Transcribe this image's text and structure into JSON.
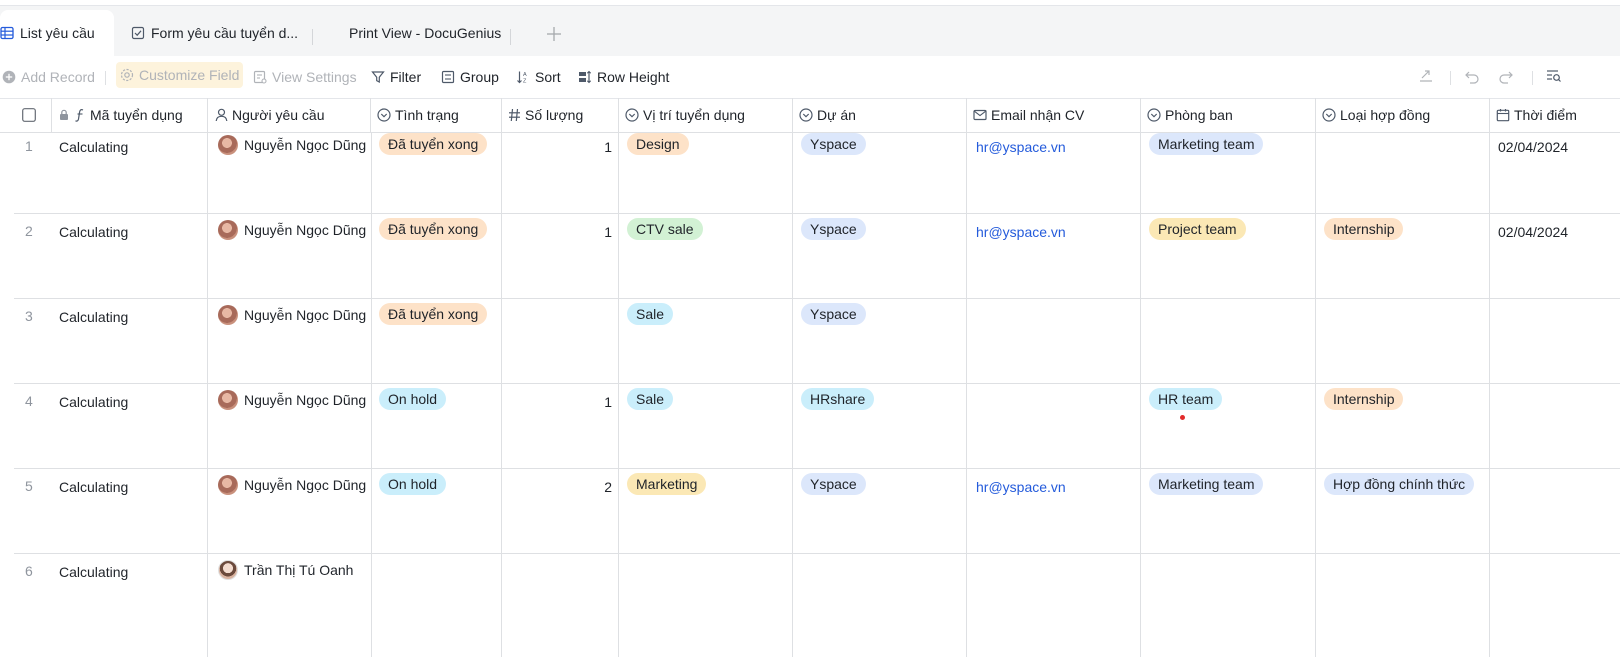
{
  "tabs": [
    {
      "label": "List yêu cầu",
      "icon": "grid-icon",
      "active": true
    },
    {
      "label": "Form yêu cầu tuyển d...",
      "icon": "form-check-icon",
      "active": false
    },
    {
      "label": "Print View - DocuGenius",
      "icon": "",
      "active": false
    }
  ],
  "toolbar": {
    "add_record": "Add Record",
    "customize_field": "Customize Field",
    "view_settings": "View Settings",
    "filter": "Filter",
    "group": "Group",
    "sort": "Sort",
    "row_height": "Row Height"
  },
  "columns": {
    "ma": "Mã tuyển dụng",
    "nguoi": "Người yêu cầu",
    "tinh_trang": "Tình trạng",
    "so_luong": "Số lượng",
    "vi_tri": "Vị trí tuyển dụng",
    "du_an": "Dự án",
    "email": "Email nhận CV",
    "phong_ban": "Phòng ban",
    "loai_hd": "Loại hợp đồng",
    "thoi_diem": "Thời điểm"
  },
  "rows": [
    {
      "num": "1",
      "ma": "Calculating",
      "nguoi": "Nguyễn Ngọc Dũng",
      "tinh_trang": "Đã tuyển xong",
      "so_luong": "1",
      "vi_tri": "Design",
      "du_an": "Yspace",
      "email": "hr@yspace.vn",
      "phong_ban": "Marketing team",
      "loai_hd": "",
      "thoi_diem": "02/04/2024"
    },
    {
      "num": "2",
      "ma": "Calculating",
      "nguoi": "Nguyễn Ngọc Dũng",
      "tinh_trang": "Đã tuyển xong",
      "so_luong": "1",
      "vi_tri": "CTV sale",
      "du_an": "Yspace",
      "email": "hr@yspace.vn",
      "phong_ban": "Project team",
      "loai_hd": "Internship",
      "thoi_diem": "02/04/2024"
    },
    {
      "num": "3",
      "ma": "Calculating",
      "nguoi": "Nguyễn Ngọc Dũng",
      "tinh_trang": "Đã tuyển xong",
      "so_luong": "",
      "vi_tri": "Sale",
      "du_an": "Yspace",
      "email": "",
      "phong_ban": "",
      "loai_hd": "",
      "thoi_diem": ""
    },
    {
      "num": "4",
      "ma": "Calculating",
      "nguoi": "Nguyễn Ngọc Dũng",
      "tinh_trang": "On hold",
      "so_luong": "1",
      "vi_tri": "Sale",
      "du_an": "HRshare",
      "email": "",
      "phong_ban": "HR team",
      "loai_hd": "Internship",
      "thoi_diem": ""
    },
    {
      "num": "5",
      "ma": "Calculating",
      "nguoi": "Nguyễn Ngọc Dũng",
      "tinh_trang": "On hold",
      "so_luong": "2",
      "vi_tri": "Marketing",
      "du_an": "Yspace",
      "email": "hr@yspace.vn",
      "phong_ban": "Marketing team",
      "loai_hd": "Hợp đồng chính thức",
      "thoi_diem": ""
    },
    {
      "num": "6",
      "ma": "Calculating",
      "nguoi": "Trần Thị Tú Oanh",
      "tinh_trang": "",
      "so_luong": "",
      "vi_tri": "",
      "du_an": "",
      "email": "",
      "phong_ban": "",
      "loai_hd": "",
      "thoi_diem": ""
    }
  ],
  "colors": {
    "accent": "#245bdb",
    "tag_orange": "#fde2c8",
    "tag_blue": "#dce7fb",
    "tag_green": "#d2f1d4",
    "tag_yellow": "#fbe8b5",
    "tag_cyan": "#caeefb"
  }
}
